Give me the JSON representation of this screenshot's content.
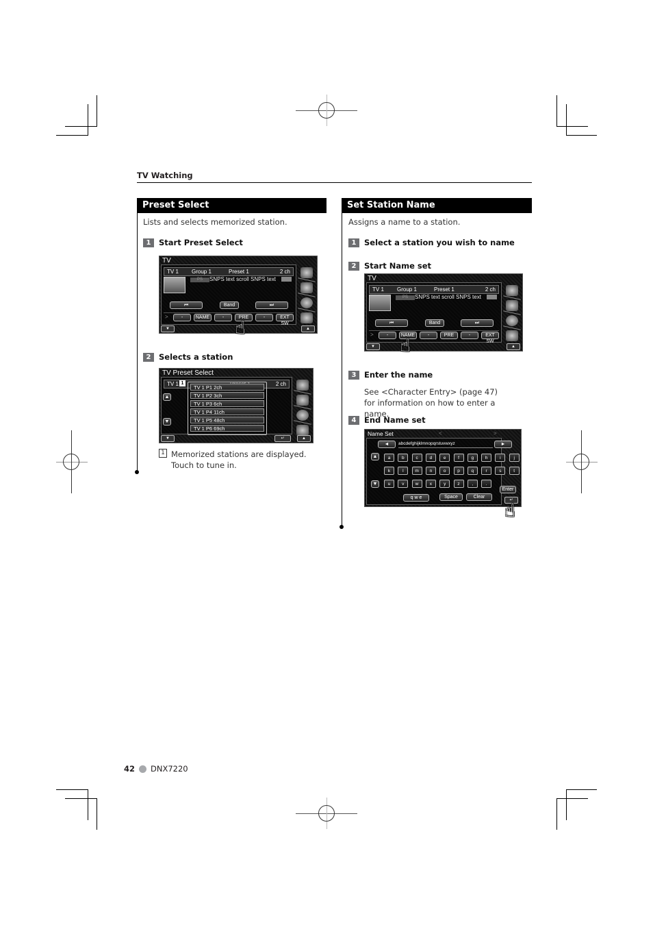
{
  "header": {
    "section": "TV Watching"
  },
  "left": {
    "title": "Preset Select",
    "intro": "Lists and selects memorized station.",
    "steps": [
      {
        "num": "1",
        "label": "Start Preset Select"
      },
      {
        "num": "2",
        "label": "Selects a station"
      }
    ],
    "note": {
      "callout": "1",
      "text": "Memorized stations are displayed. Touch to tune in."
    }
  },
  "right": {
    "title": "Set Station Name",
    "intro": "Assigns a name to a station.",
    "steps": [
      {
        "num": "1",
        "label": "Select a station you wish to name"
      },
      {
        "num": "2",
        "label": "Start Name set"
      },
      {
        "num": "3",
        "label": "Enter the name",
        "text": "See <Character Entry> (page 47) for information on how to enter a name."
      },
      {
        "num": "4",
        "label": "End Name set"
      }
    ]
  },
  "tv_screen": {
    "title": "TV",
    "source": "TV 1",
    "group": "Group 1",
    "preset": "Preset 1",
    "channel": "2 ch",
    "ps_label": "PS",
    "radio_text": "SNPS text scroll SNPS text",
    "seek_back": "⏮",
    "band": "Band",
    "seek_fwd": "⏭",
    "menu_arrow": ">",
    "function_buttons": [
      "-",
      "NAME",
      "-",
      "PRE",
      "-",
      "EXT SW"
    ],
    "down_btn": "▼",
    "up_btn": "▲"
  },
  "preset_screen": {
    "title": "TV Preset Select",
    "source": "TV 1",
    "preset": "Preset 1",
    "channel": "2 ch",
    "callout": "1",
    "scroll_up": "▲",
    "scroll_down": "▼",
    "items": [
      "TV 1  P1  2ch",
      "TV 1  P2  3ch",
      "TV 1  P3  6ch",
      "TV 1  P4  11ch",
      "TV 1  P5  48ch",
      "TV 1  P6  69ch"
    ],
    "return_btn": "↵"
  },
  "name_screen": {
    "title": "Name Set",
    "prev_tab": "<",
    "next_tab": ">",
    "cursor_left": "◄",
    "cursor_right": "►",
    "entry": "abcdefghijklmnopqrstuvwxyz",
    "scroll_up": "▲",
    "scroll_down": "▼",
    "rows": [
      [
        "a",
        "b",
        "c",
        "d",
        "e",
        "f",
        "g",
        "h",
        "i",
        "j"
      ],
      [
        "k",
        "l",
        "m",
        "n",
        "o",
        "p",
        "q",
        "r",
        "s",
        "t"
      ],
      [
        "u",
        "v",
        "w",
        "x",
        "y",
        "z",
        ",",
        "."
      ]
    ],
    "enter": "Enter",
    "qwe": "q w e",
    "space": "Space",
    "clear": "Clear",
    "return_btn": "↵"
  },
  "footer": {
    "page": "42",
    "model": "DNX7220"
  }
}
